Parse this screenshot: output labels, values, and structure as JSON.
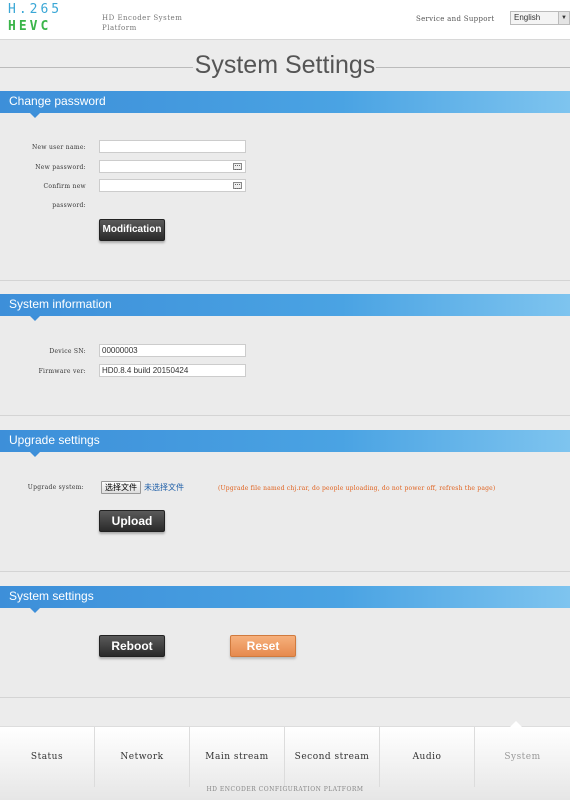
{
  "header": {
    "logo_line1": "H.265",
    "logo_line2": "HEVC",
    "platform_text": "HD Encoder System Platform",
    "service_link": "Service and Support",
    "language": "English"
  },
  "page_title": "System Settings",
  "change_password": {
    "title": "Change password",
    "user_label": "New user name:",
    "user_value": "",
    "password_label": "New password:",
    "confirm_label_line1": "Confirm new",
    "confirm_label_line2": "password:",
    "button": "Modification"
  },
  "system_information": {
    "title": "System information",
    "sn_label": "Device SN:",
    "sn_value": "00000003",
    "fw_label": "Firmware ver:",
    "fw_value": "HD0.8.4 build 20150424"
  },
  "upgrade_settings": {
    "title": "Upgrade settings",
    "label": "Upgrade system:",
    "choose_file": "选择文件",
    "no_file": "未选择文件",
    "note": "(Upgrade file named chj.rar, do people uploading, do not power off, refresh the page)",
    "button": "Upload"
  },
  "system_settings": {
    "title": "System settings",
    "reboot": "Reboot",
    "reset": "Reset"
  },
  "nav": {
    "items": [
      "Status",
      "Network",
      "Main stream",
      "Second stream",
      "Audio",
      "System"
    ],
    "active": "System"
  },
  "footer_text": "HD ENCODER CONFIGURATION PLATFORM"
}
